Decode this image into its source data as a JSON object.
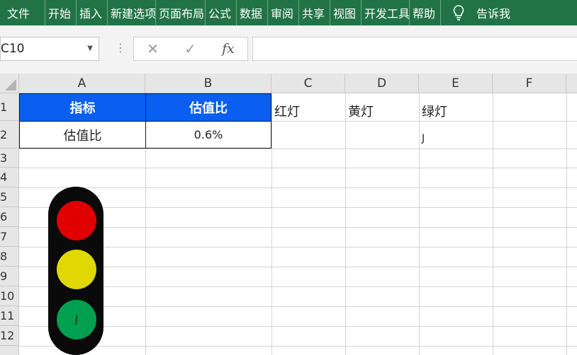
{
  "ribbon": {
    "tabs": [
      "文件",
      "开始",
      "插入",
      "新建选项",
      "页面布局",
      "公式",
      "数据",
      "审阅",
      "共享",
      "视图",
      "开发工具",
      "帮助"
    ],
    "tell_me": "告诉我"
  },
  "formula_bar": {
    "name_box": "C10",
    "formula": ""
  },
  "columns": [
    "A",
    "B",
    "C",
    "D",
    "E",
    "F"
  ],
  "rows": [
    "1",
    "2",
    "3",
    "4",
    "5",
    "6",
    "7",
    "8",
    "9",
    "10",
    "11",
    "12"
  ],
  "cells": {
    "A1": "指标",
    "B1": "估值比",
    "A2": "估值比",
    "B2": "0.6%",
    "C1": "红灯",
    "D1": "黄灯",
    "E1": "绿灯",
    "E2": "J"
  },
  "traffic_light": {
    "red": "#e00000",
    "yellow": "#e0d800",
    "green": "#00a050",
    "green_symbol": "J"
  },
  "colors": {
    "ribbon": "#217346",
    "header_fill": "#0a5ef0"
  }
}
